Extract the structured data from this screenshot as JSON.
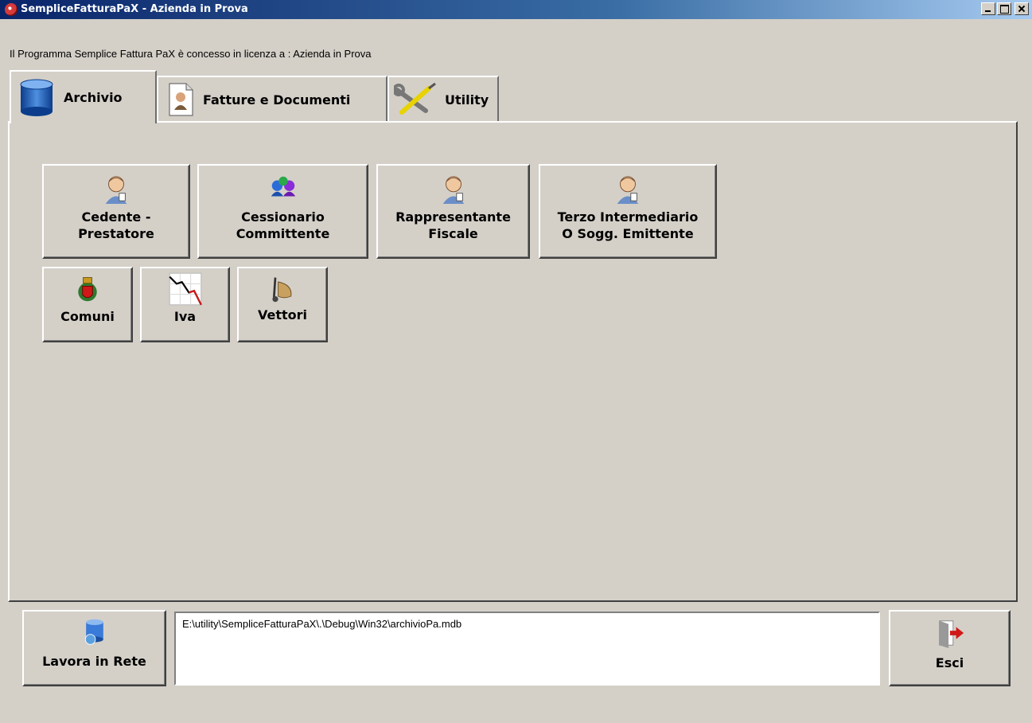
{
  "window": {
    "title": "SempliceFatturaPaX - Azienda in Prova",
    "icon": "app-globe-icon"
  },
  "license_text": "Il Programma Semplice Fattura PaX è concesso in licenza a : Azienda in Prova",
  "tabs": [
    {
      "label": "Archivio",
      "icon": "database-icon",
      "active": true
    },
    {
      "label": "Fatture e Documenti",
      "icon": "document-icon",
      "active": false
    },
    {
      "label": "Utility",
      "icon": "tools-icon",
      "active": false
    }
  ],
  "archive_buttons": [
    {
      "label": "Cedente -\nPrestatore",
      "icon": "person-icon"
    },
    {
      "label": "Cessionario\nCommittente",
      "icon": "group-icon"
    },
    {
      "label": "Rappresentante\nFiscale",
      "icon": "person-icon"
    },
    {
      "label": "Terzo Intermediario\nO Sogg. Emittente",
      "icon": "person-icon"
    },
    {
      "label": "Comuni",
      "icon": "coat-of-arms-icon"
    },
    {
      "label": "Iva",
      "icon": "chart-down-icon"
    },
    {
      "label": "Vettori",
      "icon": "hand-truck-icon"
    }
  ],
  "footer": {
    "network_button": "Lavora in Rete",
    "db_path": "E:\\utility\\SempliceFatturaPaX\\.\\Debug\\Win32\\archivioPa.mdb",
    "exit_button": "Esci"
  }
}
